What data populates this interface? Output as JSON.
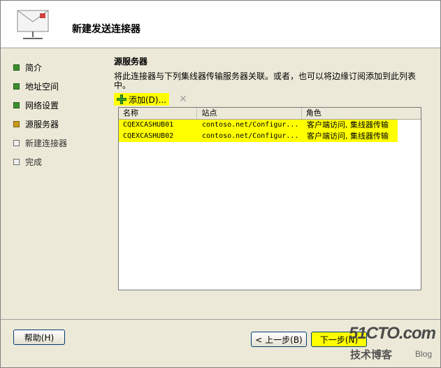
{
  "header": {
    "title": "新建发送连接器",
    "icon": "wizard-envelope-icon"
  },
  "sidebar": {
    "steps": [
      {
        "label": "简介",
        "state": "done"
      },
      {
        "label": "地址空间",
        "state": "done"
      },
      {
        "label": "网络设置",
        "state": "done"
      },
      {
        "label": "源服务器",
        "state": "current"
      },
      {
        "label": "新建连接器",
        "state": "pending"
      },
      {
        "label": "完成",
        "state": "pending"
      }
    ]
  },
  "main": {
    "section_title": "源服务器",
    "description": "将此连接器与下列集线器传输服务器关联。或者，也可以将边缘订阅添加到此列表中。",
    "toolbar": {
      "add_label": "添加(D)...",
      "remove_icon": "remove-x-icon"
    },
    "table": {
      "columns": [
        "名称",
        "站点",
        "角色"
      ],
      "rows": [
        {
          "name": "CQEXCASHUB01",
          "site": "contoso.net/Configur...",
          "role": "客户端访问, 集线器传输"
        },
        {
          "name": "CQEXCASHUB02",
          "site": "contoso.net/Configur...",
          "role": "客户端访问, 集线器传输"
        }
      ]
    }
  },
  "footer": {
    "help_label": "帮助(H)",
    "back_label": "< 上一步(B)",
    "next_label": "下一步(N)"
  },
  "watermark": {
    "main": "51CTO.com",
    "sub": "技术博客",
    "blog": "Blog"
  },
  "colors": {
    "highlight": "#ffff00",
    "done": "#3a8f2b",
    "current": "#c99a1a"
  }
}
